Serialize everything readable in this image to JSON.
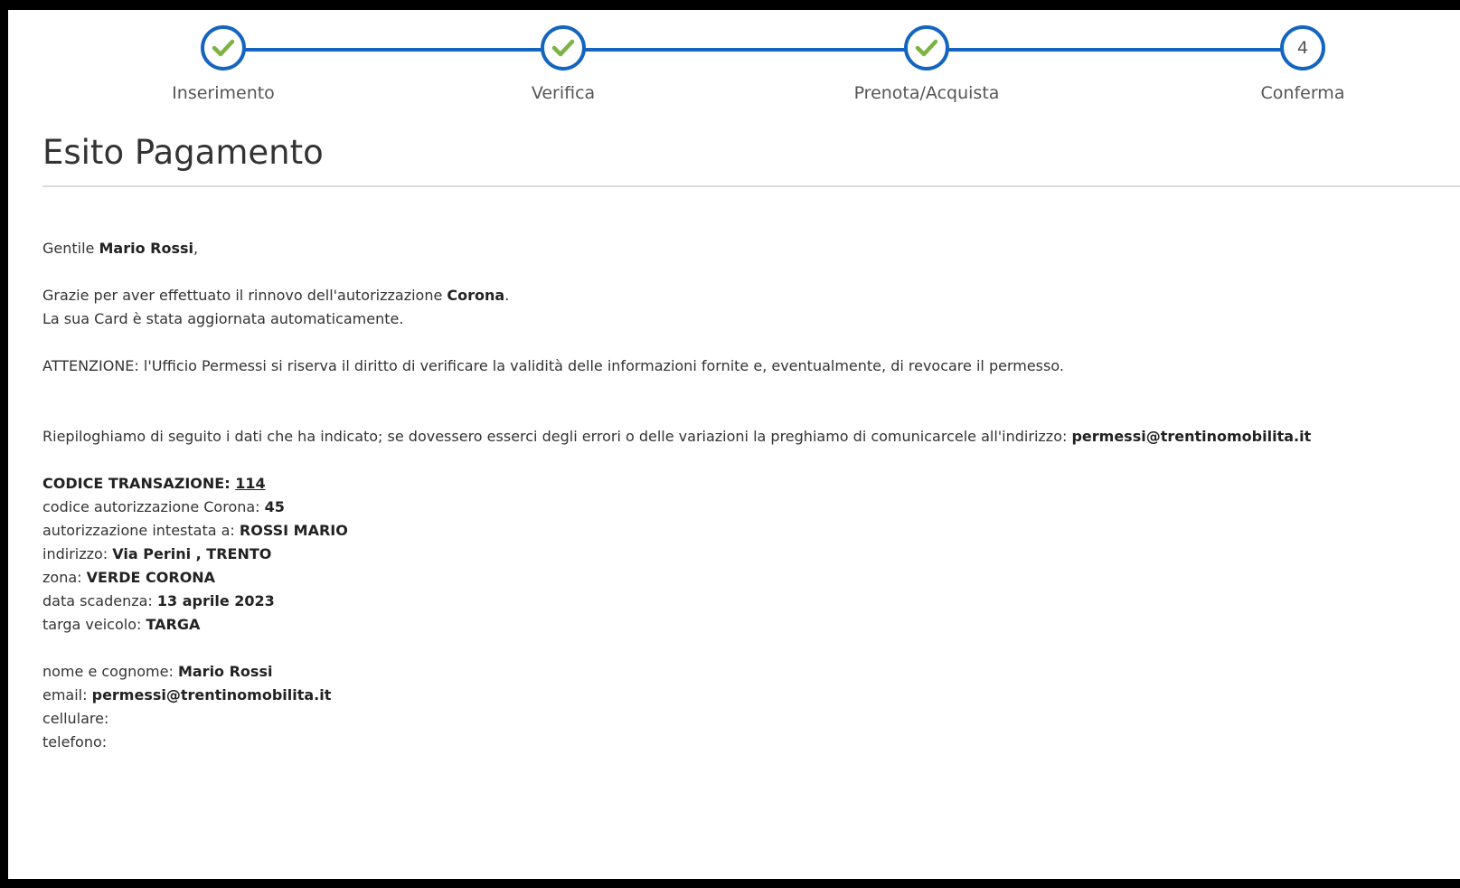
{
  "stepper": {
    "steps": [
      {
        "label": "Inserimento",
        "state": "done"
      },
      {
        "label": "Verifica",
        "state": "done"
      },
      {
        "label": "Prenota/Acquista",
        "state": "done"
      },
      {
        "label": "Conferma",
        "state": "current",
        "number": "4"
      }
    ]
  },
  "page_title": "Esito Pagamento",
  "greeting": {
    "prefix": "Gentile ",
    "name": "Mario Rossi",
    "suffix": ","
  },
  "thanks": {
    "prefix": "Grazie per aver effettuato il rinnovo dell'autorizzazione ",
    "authorization": "Corona",
    "suffix": ".",
    "line2": "La sua Card è stata aggiornata automaticamente."
  },
  "warning": "ATTENZIONE: l'Ufficio Permessi si riserva il diritto di verificare la validità delle informazioni fornite e, eventualmente, di revocare il permesso.",
  "summary": {
    "text": "Riepiloghiamo di seguito i dati che ha indicato; se dovessero esserci degli errori o delle variazioni la preghiamo di comunicarcele all'indirizzo: ",
    "email": "permessi@trentinomobilita.it"
  },
  "transaction": {
    "label": "CODICE TRANSAZIONE: ",
    "code": "114"
  },
  "details": [
    {
      "label": "codice autorizzazione Corona: ",
      "value": "45"
    },
    {
      "label": "autorizzazione intestata a: ",
      "value": "ROSSI MARIO"
    },
    {
      "label": "indirizzo: ",
      "value": "Via Perini , TRENTO"
    },
    {
      "label": "zona: ",
      "value": "VERDE CORONA"
    },
    {
      "label": "data scadenza: ",
      "value": "13 aprile 2023"
    },
    {
      "label": "targa veicolo: ",
      "value": "TARGA"
    }
  ],
  "contact": [
    {
      "label": "nome e cognome: ",
      "value": "Mario Rossi"
    },
    {
      "label": "email: ",
      "value": "permessi@trentinomobilita.it"
    },
    {
      "label": "cellulare:",
      "value": ""
    },
    {
      "label": "telefono:",
      "value": ""
    }
  ],
  "colors": {
    "accent": "#1565c0",
    "check": "#7cb342",
    "text": "#333333"
  }
}
